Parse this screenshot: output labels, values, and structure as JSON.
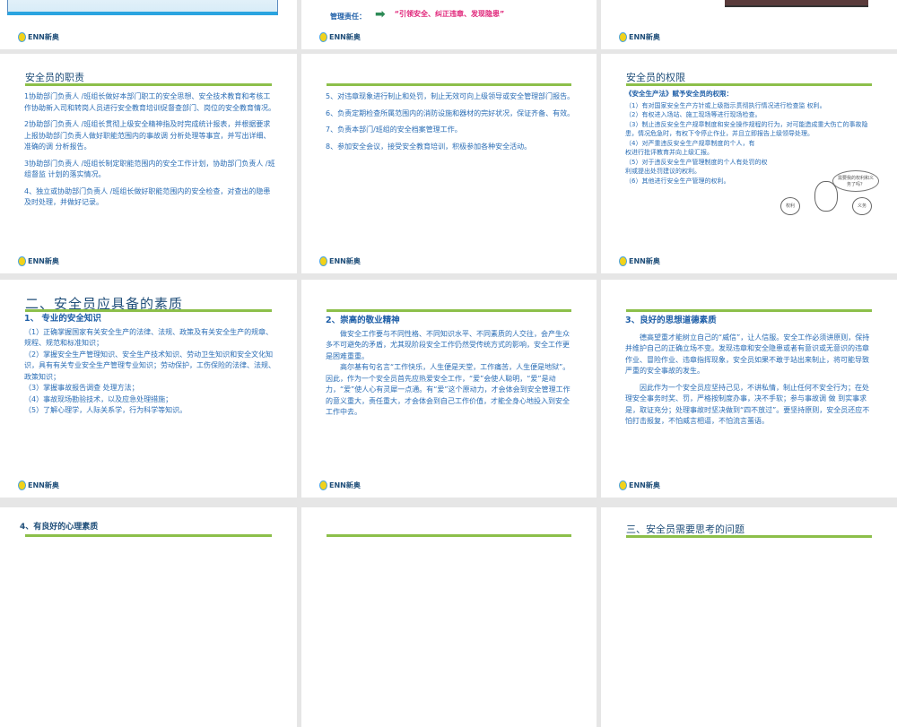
{
  "logo_text": "ENN新奥",
  "row0": {
    "mid_label": "管理责任：",
    "mid_quote": "“引领安全、纠正违章、发现隐患”"
  },
  "s1": {
    "title": "安全员的职责",
    "paras": [
      "1协助部门负责人 /班组长做好本部门职工的安全思想、安全技术教育和考核工作协助新入司和转岗人员进行安全教育培训促督查部门、岗位的安全教育情况。",
      "2协助部门负责人 /班组长贯彻上级安全精神指及时完成统计报表，并根据要求上报协助部门负责人做好职能范围内的事故调 分析处理等事宜，并写出详细、准确的调 分析报告。",
      "3协助部门负责人 /班组长制定职能范围内的安全工作计划，协助部门负责人 /班组督监 计划的落实情况。",
      "4、独立或协助部门负责人 /班组长做好职能范围内的安全检查，对查出的隐患及时处理，并做好记录。"
    ]
  },
  "s2": {
    "paras": [
      "5、对违章现象进行制止和处罚，制止无效可向上级领导或安全管理部门报告。",
      "6、负责定期检查所属范围内的消防设施和器材的完好状况，保证齐备、有效。",
      "7、负责本部门/班组的安全档案管理工作。",
      "8、参加安全会议，接受安全教育培训，积极参加各种安全活动。"
    ]
  },
  "s3": {
    "title": "安全员的权限",
    "lead": "《安全生产法》赋予安全员的权限：",
    "items": [
      "（1）有对国家安全生产方针或上级指示贯彻执行情况进行检查监 权利。",
      "（2）有权进入场站、施工现场等进行现场检查。",
      "（3）制止违反安全生产规章制度和安全操作规程的行为，对可能造成重大伤亡的事故隐患，情况危急时，有权下令停止作业，并且立即报告上级领导处理。",
      "（4）对严重违反安全生产规章制度的个人，有权进行批评教育并向上级汇报。",
      "（5）对于违反安全生产管理制度的个人有处罚的权利或提出处罚建议的权利。",
      "（6）其他进行安全生产管理的权利。"
    ],
    "cartoon": {
      "bubble": "需要我的权利和义务了吗？",
      "left_apple": "权利",
      "right_apple": "义务"
    }
  },
  "s4": {
    "title": "二、安全员应具备的素质",
    "heading": "1、 专业的安全知识",
    "items": [
      "（1）正确掌握国家有关安全生产的法律、法规、政策及有关安全生产的规章、规程、规范和标准知识；",
      "（2）掌握安全生产管理知识、安全生产技术知识、劳动卫生知识和安全文化知识，具有有关专业安全生产管理专业知识；劳动保护，工伤保险的法律、法规、政策知识；",
      "（3）掌握事故报告调查 处理方法；",
      "（4）事故现场勘验技术，以及应急处理措施；",
      "（5）了解心理学，人际关系学，行为科学等知识。"
    ]
  },
  "s5": {
    "heading": "2、崇高的敬业精神",
    "paras": [
      "做安全工作要与不同性格、不同知识水平、不同素质的人交往，会产生众多不可避免的矛盾，尤其现阶段安全工作仍然受传统方式的影响，安全工作更是困难重重。",
      "高尔基有句名言“工作快乐，人生便是天堂，工作痛苦，人生便是地狱”。因此，作为一个安全员首先应热爱安全工作，“爱”会使人聪明，“爱”是动力，“爱”使人心有灵犀一点通。有“爱”这个原动力，才会体会到安全管理工作的意义重大，责任重大，才会体会到自己工作价值，才能全身心地投入到安全工作中去。"
    ]
  },
  "s6": {
    "heading": "3、良好的思想道德素质",
    "paras": [
      "德高望重才能树立自己的“威信”，让人信服。安全工作必须讲原则，保持并维护自己的正确立场不变。发现违章和安全隐患或者有意识或无意识的违章作业、冒险作业、违章指挥现象，安全员如果不敢于站出来制止，将可能导致严重的安全事故的发生。",
      "因此作为一个安全员应坚持己见，不讲私情，制止任何不安全行为；在处理安全事务时奖、罚，严格按制度办事，决不手软；参与事故调 做 到实事求是，取证充分；处理事故时坚决做到“四不放过”。要坚持原则，安全员还应不怕打击报复，不怕威言相逼，不怕流言蜚语。"
    ]
  },
  "s7": {
    "title": "4、有良好的心理素质"
  },
  "s9": {
    "title": "三、安全员需要思考的问题"
  }
}
